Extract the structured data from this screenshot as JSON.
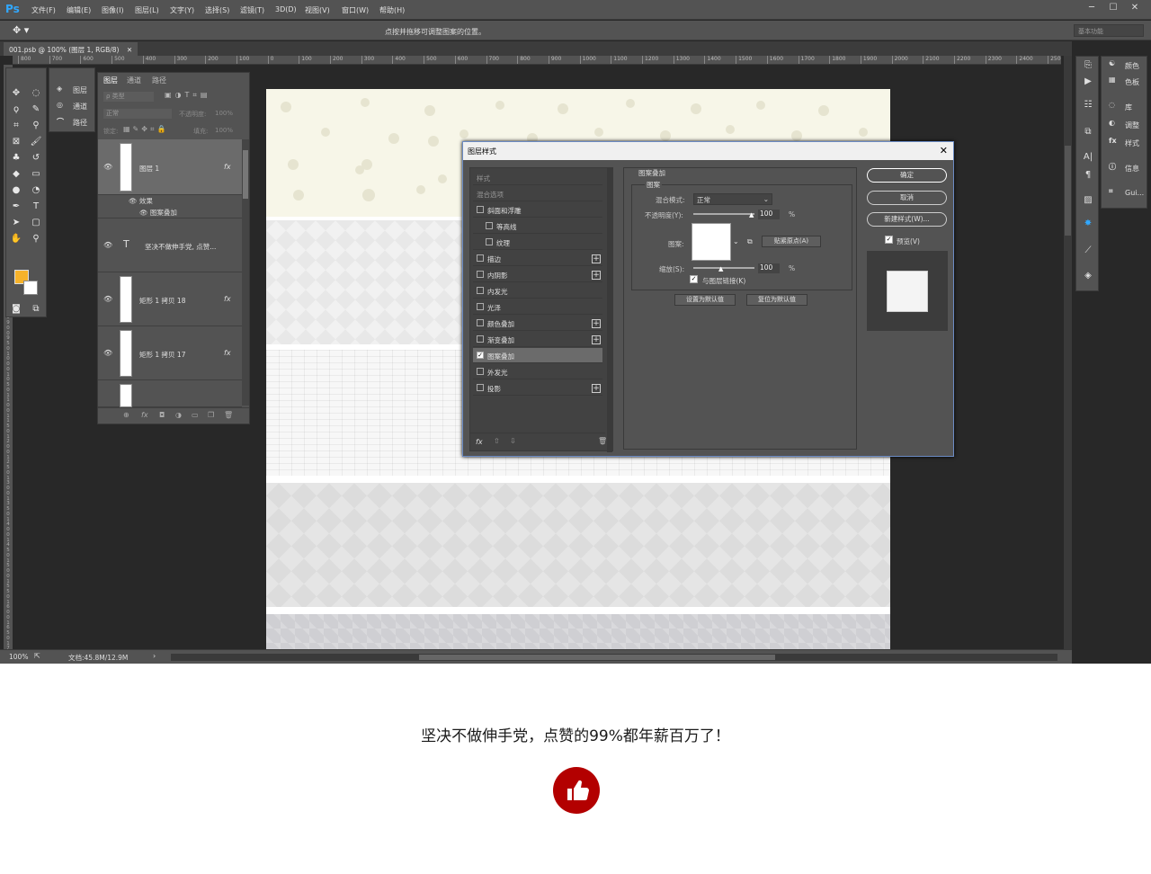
{
  "menubar": {
    "logo": "Ps",
    "items": [
      "文件(F)",
      "编辑(E)",
      "图像(I)",
      "图层(L)",
      "文字(Y)",
      "选择(S)",
      "滤镜(T)",
      "3D(D)",
      "视图(V)",
      "窗口(W)",
      "帮助(H)"
    ]
  },
  "options": {
    "hint": "点按并拖移可调整图案的位置。",
    "workspace": "基本功能"
  },
  "document": {
    "tab": "001.psb @ 100% (图层 1, RGB/8)",
    "zoom": "100%",
    "docinfo": "文档:45.8M/12.9M"
  },
  "ruler": {
    "top": [
      "800",
      "700",
      "600",
      "500",
      "400",
      "300",
      "200",
      "100",
      "0",
      "100",
      "200",
      "300",
      "400",
      "500",
      "600",
      "700",
      "800",
      "900",
      "1000",
      "1100",
      "1200",
      "1300",
      "1400",
      "1500",
      "1600",
      "1700",
      "1800",
      "1900",
      "2000",
      "2100",
      "2200",
      "2300",
      "2400",
      "2500"
    ],
    "left": [
      "1",
      "0",
      "0",
      "1",
      "5",
      "0",
      "2",
      "0",
      "0",
      "2",
      "5",
      "0",
      "3",
      "0",
      "0",
      "3",
      "5",
      "0",
      "4",
      "0",
      "0",
      "4",
      "5",
      "0",
      "5",
      "0",
      "0",
      "5",
      "5",
      "0",
      "6",
      "0",
      "0",
      "6",
      "5",
      "0",
      "7",
      "0",
      "0",
      "7",
      "5",
      "0",
      "8",
      "0",
      "0",
      "8",
      "5",
      "0",
      "9",
      "0",
      "0",
      "9",
      "5",
      "0",
      "1",
      "0",
      "0",
      "0",
      "1",
      "0",
      "5",
      "0",
      "1",
      "1",
      "0",
      "0",
      "1",
      "1",
      "5",
      "0",
      "1",
      "2",
      "0",
      "0",
      "1",
      "2",
      "5",
      "0",
      "1",
      "3",
      "0",
      "0",
      "1",
      "3",
      "5",
      "0",
      "1",
      "4",
      "0",
      "0",
      "1",
      "4",
      "5",
      "0",
      "1",
      "5",
      "0",
      "0",
      "1",
      "5",
      "5",
      "0",
      "1",
      "6",
      "0",
      "0",
      "1",
      "6",
      "5",
      "0",
      "1",
      "7",
      "0",
      "0"
    ]
  },
  "mini_panel": {
    "items": [
      "图层",
      "通道",
      "路径"
    ]
  },
  "layers": {
    "tabs": [
      "图层",
      "通道",
      "路径"
    ],
    "filter_label": "ρ 类型",
    "blend_mode": "正常",
    "opacity_label": "不透明度:",
    "opacity_value": "100%",
    "lock_label": "锁定:",
    "fill_label": "填充:",
    "fill_value": "100%",
    "rows": [
      {
        "name": "图层 1",
        "fx": "fx"
      },
      {
        "name": "坚决不做伸手党, 点赞...",
        "type_icon": "T"
      },
      {
        "name": "矩形 1 拷贝 18",
        "fx": "fx"
      },
      {
        "name": "矩形 1 拷贝 17",
        "fx": "fx"
      }
    ],
    "effects_label": "效果",
    "effect_item": "图案叠加",
    "bottom_icons": [
      "⊕",
      "fx",
      "◘",
      "◑",
      "▭",
      "❐",
      "🗑"
    ]
  },
  "dialog": {
    "title": "图层样式",
    "styles": [
      {
        "label": "样式",
        "checkbox": false,
        "plus": false,
        "header": true
      },
      {
        "label": "混合选项",
        "checkbox": false,
        "plus": false,
        "header": true
      },
      {
        "label": "斜面和浮雕",
        "checkbox": true,
        "plus": false
      },
      {
        "label": "等高线",
        "checkbox": true,
        "plus": false,
        "indent": true
      },
      {
        "label": "纹理",
        "checkbox": true,
        "plus": false,
        "indent": true
      },
      {
        "label": "描边",
        "checkbox": true,
        "plus": true
      },
      {
        "label": "内阴影",
        "checkbox": true,
        "plus": true
      },
      {
        "label": "内发光",
        "checkbox": true,
        "plus": false
      },
      {
        "label": "光泽",
        "checkbox": true,
        "plus": false
      },
      {
        "label": "颜色叠加",
        "checkbox": true,
        "plus": true
      },
      {
        "label": "渐变叠加",
        "checkbox": true,
        "plus": true
      },
      {
        "label": "图案叠加",
        "checkbox": true,
        "plus": false,
        "checked": true,
        "active": true
      },
      {
        "label": "外发光",
        "checkbox": true,
        "plus": false
      },
      {
        "label": "投影",
        "checkbox": true,
        "plus": true
      }
    ],
    "section_title": "图案叠加",
    "group_title": "图案",
    "blend_label": "混合模式:",
    "blend_value": "正常",
    "opacity_label": "不透明度(Y):",
    "opacity_value": "100",
    "pattern_label": "图案:",
    "snap_button": "贴紧原点(A)",
    "scale_label": "缩放(S):",
    "scale_value": "100",
    "percent": "%",
    "link_label": "与图层链接(K)",
    "default_button": "设置为默认值",
    "reset_button": "复位为默认值",
    "ok_button": "确定",
    "cancel_button": "取消",
    "new_style_button": "新建样式(W)...",
    "preview_label": "预览(V)",
    "fx_label": "fx"
  },
  "right_panels": {
    "items": [
      "颜色",
      "色板",
      "库",
      "调整",
      "样式",
      "信息",
      "Gui..."
    ]
  },
  "footer": {
    "text": "坚决不做伸手党，点赞的99%都年薪百万了！"
  }
}
